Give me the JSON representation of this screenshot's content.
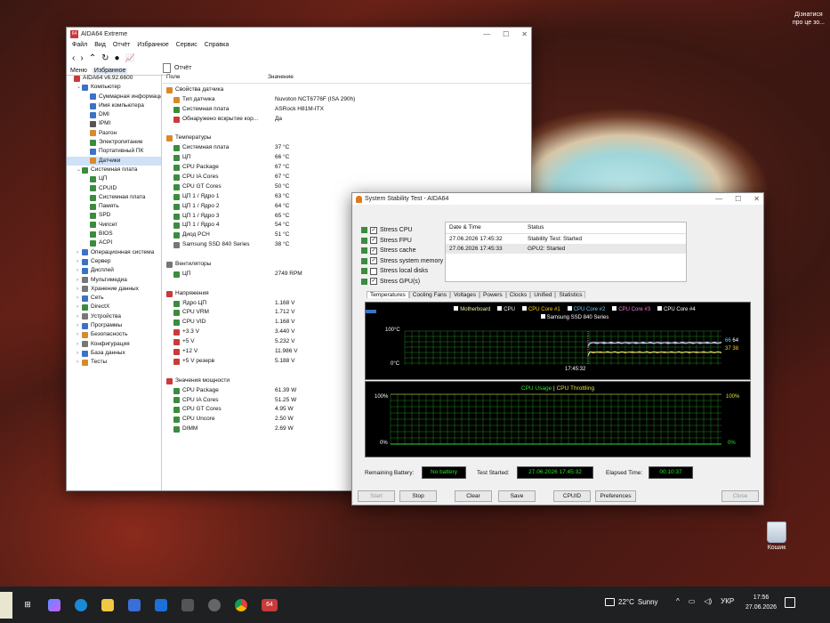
{
  "desktop": {
    "recycle_label": "Кошик",
    "corner_text_1": "Дізнатися",
    "corner_text_2": "про це зо..."
  },
  "aida": {
    "title": "AIDA64 Extreme",
    "menu": [
      "Файл",
      "Вид",
      "Отчёт",
      "Избранное",
      "Сервис",
      "Справка"
    ],
    "toolbar_report": "Отчёт",
    "tabs": [
      "Меню",
      "Избранное"
    ],
    "columns": {
      "field": "Поле",
      "value": "Значение"
    },
    "tree": [
      {
        "label": "AIDA64 v6.92.6600",
        "indent": 0,
        "arrow": "",
        "color": "#c93a3a"
      },
      {
        "label": "Компьютер",
        "indent": 1,
        "arrow": "⌄",
        "color": "#3a73c6"
      },
      {
        "label": "Суммарная информация",
        "indent": 2,
        "arrow": "",
        "color": "#3a73c6"
      },
      {
        "label": "Имя компьютера",
        "indent": 2,
        "arrow": "",
        "color": "#3a73c6"
      },
      {
        "label": "DMI",
        "indent": 2,
        "arrow": "",
        "color": "#3a73c6"
      },
      {
        "label": "IPMI",
        "indent": 2,
        "arrow": "",
        "color": "#555"
      },
      {
        "label": "Разгон",
        "indent": 2,
        "arrow": "",
        "color": "#d88a2a"
      },
      {
        "label": "Электропитание",
        "indent": 2,
        "arrow": "",
        "color": "#3b8c3f"
      },
      {
        "label": "Портативный ПК",
        "indent": 2,
        "arrow": "",
        "color": "#3a73c6"
      },
      {
        "label": "Датчики",
        "indent": 2,
        "arrow": "",
        "color": "#d88a2a",
        "selected": true
      },
      {
        "label": "Системная плата",
        "indent": 1,
        "arrow": "⌄",
        "color": "#3b8c3f"
      },
      {
        "label": "ЦП",
        "indent": 2,
        "arrow": "",
        "color": "#3b8c3f"
      },
      {
        "label": "CPUID",
        "indent": 2,
        "arrow": "",
        "color": "#3b8c3f"
      },
      {
        "label": "Системная плата",
        "indent": 2,
        "arrow": "",
        "color": "#3b8c3f"
      },
      {
        "label": "Память",
        "indent": 2,
        "arrow": "",
        "color": "#3b8c3f"
      },
      {
        "label": "SPD",
        "indent": 2,
        "arrow": "",
        "color": "#3b8c3f"
      },
      {
        "label": "Чипсет",
        "indent": 2,
        "arrow": "",
        "color": "#3b8c3f"
      },
      {
        "label": "BIOS",
        "indent": 2,
        "arrow": "",
        "color": "#3b8c3f"
      },
      {
        "label": "ACPI",
        "indent": 2,
        "arrow": "",
        "color": "#3b8c3f"
      },
      {
        "label": "Операционная система",
        "indent": 1,
        "arrow": "›",
        "color": "#3a73c6"
      },
      {
        "label": "Сервер",
        "indent": 1,
        "arrow": "›",
        "color": "#3a73c6"
      },
      {
        "label": "Дисплей",
        "indent": 1,
        "arrow": "›",
        "color": "#3a73c6"
      },
      {
        "label": "Мультимедиа",
        "indent": 1,
        "arrow": "›",
        "color": "#777"
      },
      {
        "label": "Хранение данных",
        "indent": 1,
        "arrow": "›",
        "color": "#777"
      },
      {
        "label": "Сеть",
        "indent": 1,
        "arrow": "›",
        "color": "#3a73c6"
      },
      {
        "label": "DirectX",
        "indent": 1,
        "arrow": "›",
        "color": "#3b8c3f"
      },
      {
        "label": "Устройства",
        "indent": 1,
        "arrow": "›",
        "color": "#777"
      },
      {
        "label": "Программы",
        "indent": 1,
        "arrow": "›",
        "color": "#3a73c6"
      },
      {
        "label": "Безопасность",
        "indent": 1,
        "arrow": "›",
        "color": "#d88a2a"
      },
      {
        "label": "Конфигурация",
        "indent": 1,
        "arrow": "›",
        "color": "#777"
      },
      {
        "label": "База данных",
        "indent": 1,
        "arrow": "›",
        "color": "#3a73c6"
      },
      {
        "label": "Тесты",
        "indent": 1,
        "arrow": "›",
        "color": "#d88a2a"
      }
    ],
    "rows": [
      {
        "f": "Свойства датчика",
        "v": "",
        "sec": true,
        "c": "#d88a2a"
      },
      {
        "f": "Тип датчика",
        "v": "Nuvoton NCT6776F  (ISA 290h)",
        "ind": 1,
        "c": "#d88a2a"
      },
      {
        "f": "Системная плата",
        "v": "ASRock H81M-ITX",
        "ind": 1,
        "c": "#3b8c3f"
      },
      {
        "f": "Обнаружено вскрытие кор...",
        "v": "Да",
        "ind": 1,
        "c": "#c93a3a"
      },
      {
        "f": "",
        "v": ""
      },
      {
        "f": "Температуры",
        "v": "",
        "sec": true,
        "c": "#d88a2a"
      },
      {
        "f": "Системная плата",
        "v": "37 °C",
        "ind": 1,
        "c": "#3b8c3f"
      },
      {
        "f": "ЦП",
        "v": "66 °C",
        "ind": 1,
        "c": "#3b8c3f"
      },
      {
        "f": "CPU Package",
        "v": "67 °C",
        "ind": 1,
        "c": "#3b8c3f"
      },
      {
        "f": "CPU IA Cores",
        "v": "67 °C",
        "ind": 1,
        "c": "#3b8c3f"
      },
      {
        "f": "CPU GT Cores",
        "v": "50 °C",
        "ind": 1,
        "c": "#3b8c3f"
      },
      {
        "f": "ЦП 1 / Ядро 1",
        "v": "63 °C",
        "ind": 1,
        "c": "#3b8c3f"
      },
      {
        "f": "ЦП 1 / Ядро 2",
        "v": "64 °C",
        "ind": 1,
        "c": "#3b8c3f"
      },
      {
        "f": "ЦП 1 / Ядро 3",
        "v": "65 °C",
        "ind": 1,
        "c": "#3b8c3f"
      },
      {
        "f": "ЦП 1 / Ядро 4",
        "v": "54 °C",
        "ind": 1,
        "c": "#3b8c3f"
      },
      {
        "f": "Диод PCH",
        "v": "51 °C",
        "ind": 1,
        "c": "#3b8c3f"
      },
      {
        "f": "Samsung SSD 840 Series",
        "v": "38 °C",
        "ind": 1,
        "c": "#777"
      },
      {
        "f": "",
        "v": ""
      },
      {
        "f": "Вентиляторы",
        "v": "",
        "sec": true,
        "c": "#777"
      },
      {
        "f": "ЦП",
        "v": "2749 RPM",
        "ind": 1,
        "c": "#3b8c3f"
      },
      {
        "f": "",
        "v": ""
      },
      {
        "f": "Напряжения",
        "v": "",
        "sec": true,
        "c": "#c93a3a"
      },
      {
        "f": "Ядро ЦП",
        "v": "1.168 V",
        "ind": 1,
        "c": "#3b8c3f"
      },
      {
        "f": "CPU VRM",
        "v": "1.712 V",
        "ind": 1,
        "c": "#3b8c3f"
      },
      {
        "f": "CPU VID",
        "v": "1.168 V",
        "ind": 1,
        "c": "#3b8c3f"
      },
      {
        "f": "+3.3 V",
        "v": "3.440 V",
        "ind": 1,
        "c": "#c93a3a"
      },
      {
        "f": "+5 V",
        "v": "5.232 V",
        "ind": 1,
        "c": "#c93a3a"
      },
      {
        "f": "+12 V",
        "v": "11.986 V",
        "ind": 1,
        "c": "#c93a3a"
      },
      {
        "f": "+5 V резерв",
        "v": "5.188 V",
        "ind": 1,
        "c": "#c93a3a"
      },
      {
        "f": "",
        "v": ""
      },
      {
        "f": "Значения мощности",
        "v": "",
        "sec": true,
        "c": "#c93a3a"
      },
      {
        "f": "CPU Package",
        "v": "61.39 W",
        "ind": 1,
        "c": "#3b8c3f"
      },
      {
        "f": "CPU IA Cores",
        "v": "51.25 W",
        "ind": 1,
        "c": "#3b8c3f"
      },
      {
        "f": "CPU GT Cores",
        "v": "4.95 W",
        "ind": 1,
        "c": "#3b8c3f"
      },
      {
        "f": "CPU Uncore",
        "v": "2.50 W",
        "ind": 1,
        "c": "#3b8c3f"
      },
      {
        "f": "DIMM",
        "v": "2.69 W",
        "ind": 1,
        "c": "#3b8c3f"
      }
    ]
  },
  "stability": {
    "title": "System Stability Test - AIDA64",
    "stress": [
      {
        "label": "Stress CPU",
        "checked": true
      },
      {
        "label": "Stress FPU",
        "checked": true
      },
      {
        "label": "Stress cache",
        "checked": true
      },
      {
        "label": "Stress system memory",
        "checked": true
      },
      {
        "label": "Stress local disks",
        "checked": false
      },
      {
        "label": "Stress GPU(s)",
        "checked": true
      }
    ],
    "log_headers": {
      "date": "Date & Time",
      "status": "Status"
    },
    "log": [
      {
        "date": "27.06.2026 17:45:32",
        "status": "Stability Test: Started"
      },
      {
        "date": "27.06.2026 17:45:33",
        "status": "GPU2: Started"
      }
    ],
    "tabs": [
      "Temperatures",
      "Cooling Fans",
      "Voltages",
      "Powers",
      "Clocks",
      "Unified",
      "Statistics"
    ],
    "temp_legend": [
      {
        "label": "Motherboard",
        "color": "#f2f2a0"
      },
      {
        "label": "CPU",
        "color": "#ffffff"
      },
      {
        "label": "CPU Core #1",
        "color": "#ffd400"
      },
      {
        "label": "CPU Core #2",
        "color": "#5fd0ff"
      },
      {
        "label": "CPU Core #3",
        "color": "#ff7ae0"
      },
      {
        "label": "CPU Core #4",
        "color": "#ffffff"
      },
      {
        "label": "Samsung SSD 840 Series",
        "color": "#ffffff"
      }
    ],
    "temp_top": "100°C",
    "temp_bottom": "0°C",
    "temp_time": "17:45:32",
    "temp_right_values": [
      "66",
      "64",
      "37",
      "38"
    ],
    "usage_title_1": "CPU Usage",
    "usage_sep": "|",
    "usage_title_2": "CPU Throttling",
    "usage_top_left": "100%",
    "usage_bottom_left": "0%",
    "usage_top_right": "100%",
    "usage_bottom_right": "0%",
    "battery_label": "Remaining Battery:",
    "battery_value": "No battery",
    "started_label": "Test Started:",
    "started_value": "27.06.2026 17:45:32",
    "elapsed_label": "Elapsed Time:",
    "elapsed_value": "00:10:37",
    "buttons": {
      "start": "Start",
      "stop": "Stop",
      "clear": "Clear",
      "save": "Save",
      "cpuid": "CPUID",
      "prefs": "Preferences",
      "close": "Close"
    }
  },
  "taskbar": {
    "weather_temp": "22°C",
    "weather_text": "Sunny",
    "lang": "УКР",
    "time": "17:56",
    "date": "27.06.2026",
    "aida_label": "64"
  }
}
